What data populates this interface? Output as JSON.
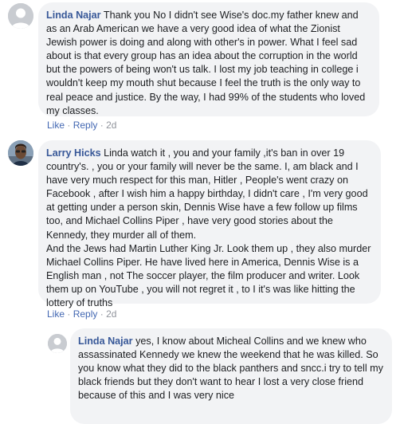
{
  "comments": [
    {
      "author": "Linda Najar",
      "text": "Thank you No I didn't see Wise's doc.my father knew and as an Arab American we have a very good idea of what the Zionist Jewish power is doing and along with other's in power. What I feel sad about is that every group has an idea about the corruption in the world but the powers of being won't us talk. I lost my job teaching in college i wouldn't keep my mouth shut because I feel the truth is the only way to real peace and justice. By the way, I had 99% of the students who loved my classes.",
      "like_label": "Like",
      "reply_label": "Reply",
      "separator": "·",
      "time": "2d",
      "avatar_icon": "default-avatar-icon"
    },
    {
      "author": "Larry Hicks",
      "text": "Linda watch it , you and your family ,it's ban in over 19 country's. , you or your family will never be the same. I, am black and I have very much respect for this man, Hitler , People's went crazy on Facebook , after I wish him a happy birthday, I didn't care , I'm very good at getting under a person skin, Dennis Wise have a few follow up films too, and Michael Collins Piper , have very good stories about the Kennedy, they murder all of them.\nAnd the Jews had Martin Luther King Jr. Look them up , they also murder Michael Collins Piper. He have lived here in America, Dennis Wise is a English man , not The soccer player, the film producer and writer. Look them up on YouTube , you will not regret it , to I it's was like hitting the lottery of truths",
      "like_label": "Like",
      "reply_label": "Reply",
      "separator": "·",
      "time": "2d",
      "avatar_icon": "user-photo-avatar"
    },
    {
      "author": "Linda Najar",
      "text": "yes, I know about Micheal Collins and we knew who assassinated Kennedy we knew the weekend that he was killed. So you know what they did to the black panthers and sncc.i try to tell my black friends but they don't want to hear I lost a very close friend because of this and I was very nice",
      "avatar_icon": "default-avatar-icon"
    }
  ],
  "colors": {
    "author": "#385898",
    "link": "#4267b2",
    "bubble": "#f2f3f5",
    "meta": "#90949c"
  }
}
